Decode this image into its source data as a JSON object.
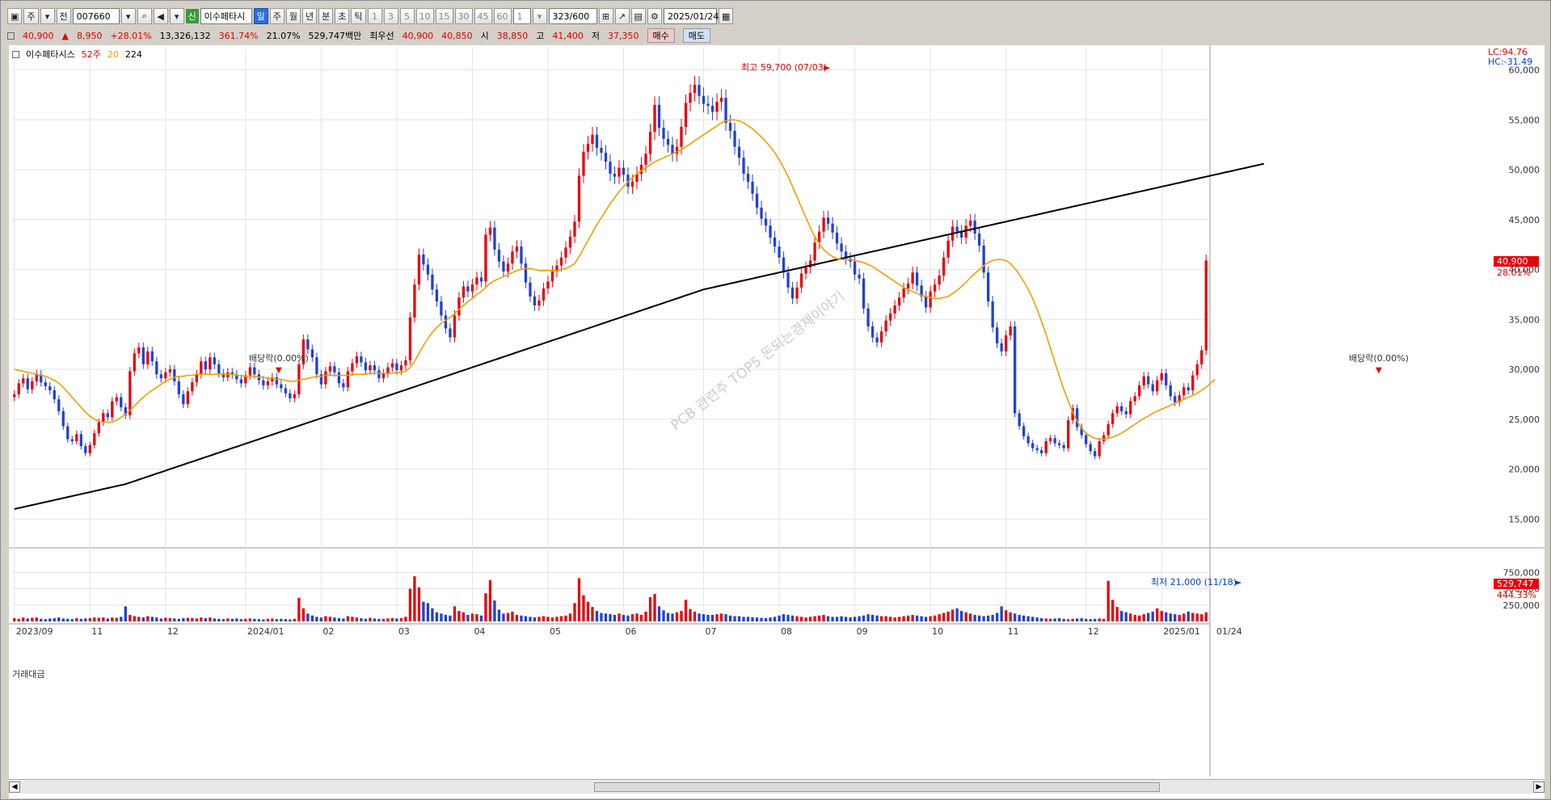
{
  "toolbar": {
    "mode": "주",
    "scope": "전",
    "code": "007660",
    "new_badge": "신",
    "name": "이수페타시",
    "periods": [
      "일",
      "주",
      "월",
      "년",
      "분",
      "초",
      "틱"
    ],
    "numbers": [
      "1",
      "3",
      "5",
      "10",
      "15",
      "30",
      "45",
      "60"
    ],
    "count_value": "1",
    "range": "323/600",
    "date": "2025/01/24"
  },
  "quote": {
    "price": "40,900",
    "change": "8,950",
    "change_pct": "+28.01%",
    "volume": "13,326,132",
    "vol_ratio": "361.74%",
    "turnover": "21.07%",
    "amount": "529,747백만",
    "priority_label": "최우선",
    "bid": "40,900",
    "ask": "40,850",
    "open_label": "시",
    "open": "38,850",
    "high_label": "고",
    "high": "41,400",
    "low_label": "저",
    "low": "37,350",
    "buy": "매수",
    "sell": "매도"
  },
  "legend": {
    "name": "이수페타시스",
    "ma1": "52주",
    "ma2": "20",
    "ma3": "224"
  },
  "volume_label": "거래대금",
  "scale_box": {
    "lc": "LC:94.76",
    "hc": "HC:-31.49"
  },
  "watermark": "PCB 관련주 TOP5 돈되는경제이야기",
  "annotations": {
    "high": "최고 59,700 (07/03)",
    "low": "최저 21,000 (11/18)",
    "div1": "배당락(0.00%)",
    "div2": "배당락(0.00%)"
  },
  "tags": {
    "price": "40,900",
    "price_pct": "28.01%",
    "vol": "529,747",
    "vol_pct": "444.33%"
  },
  "date_axis": [
    "2023/09",
    "11",
    "12",
    "2024/01",
    "02",
    "03",
    "04",
    "05",
    "06",
    "07",
    "08",
    "09",
    "10",
    "11",
    "12",
    "2025/01",
    "01/24"
  ],
  "colors": {
    "up": "#e8000b",
    "down": "#2040d8",
    "ma20": "#f0a000",
    "ma224": "#000000",
    "grid": "#e4e4e4"
  },
  "chart_data": {
    "type": "candlestick",
    "ylim": [
      13000,
      61500
    ],
    "y_ticks": [
      "15,000",
      "20,000",
      "25,000",
      "30,000",
      "35,000",
      "40,000",
      "45,000",
      "50,000",
      "55,000",
      "60,000"
    ],
    "vol_ylim": [
      0,
      1000000
    ],
    "vol_ticks": [
      "250,000",
      "500,000",
      "750,000"
    ],
    "month_starts": [
      "2023/09",
      "11",
      "12",
      "2024/01",
      "02",
      "03",
      "04",
      "05",
      "06",
      "07",
      "08",
      "09",
      "10",
      "11",
      "12",
      "2025/01"
    ],
    "closes": [
      27500,
      28600,
      29100,
      28000,
      28800,
      29500,
      28700,
      28300,
      27900,
      27000,
      25800,
      24300,
      23000,
      22800,
      23500,
      22300,
      21600,
      22400,
      23600,
      24700,
      25600,
      25200,
      26800,
      27200,
      26200,
      25400,
      29800,
      31600,
      32200,
      30500,
      31800,
      30800,
      29500,
      29100,
      29700,
      30000,
      28800,
      27500,
      26500,
      27800,
      28700,
      29500,
      30800,
      30000,
      31200,
      30500,
      29600,
      29200,
      29700,
      29500,
      29000,
      28600,
      29400,
      30200,
      29500,
      28900,
      28400,
      28800,
      29200,
      28500,
      28100,
      27600,
      27100,
      27500,
      30500,
      33000,
      32000,
      31200,
      29500,
      28500,
      29800,
      30300,
      29700,
      28600,
      28200,
      29800,
      30600,
      31300,
      30700,
      29900,
      30400,
      29900,
      29100,
      29600,
      30200,
      30600,
      29900,
      30400,
      30900,
      35200,
      38500,
      41500,
      40500,
      39500,
      38000,
      36800,
      35400,
      34100,
      33200,
      35400,
      37200,
      38300,
      37800,
      38500,
      39200,
      38800,
      43500,
      44200,
      42000,
      40800,
      39800,
      40600,
      41800,
      42300,
      40600,
      38700,
      37300,
      36400,
      36900,
      38100,
      38800,
      39800,
      40400,
      41200,
      42200,
      43300,
      44800,
      49400,
      51800,
      52600,
      53500,
      52200,
      51700,
      50800,
      49600,
      49300,
      50200,
      49500,
      48300,
      48800,
      49600,
      50500,
      51600,
      53800,
      56500,
      54200,
      53100,
      52500,
      51600,
      52300,
      54300,
      56700,
      57700,
      58500,
      57400,
      56600,
      56400,
      55800,
      56800,
      57200,
      54700,
      53900,
      52300,
      51200,
      49600,
      48800,
      47600,
      46200,
      45100,
      44400,
      43200,
      42300,
      41200,
      39700,
      38200,
      37100,
      38200,
      39600,
      40200,
      40900,
      42700,
      43800,
      45200,
      44600,
      43700,
      42600,
      41800,
      41100,
      40800,
      39500,
      39100,
      36100,
      34300,
      33200,
      32700,
      33800,
      34900,
      35600,
      36400,
      37200,
      38100,
      38600,
      39700,
      38400,
      37300,
      36200,
      37800,
      38500,
      39400,
      41200,
      42900,
      44300,
      43800,
      43200,
      44400,
      44900,
      43600,
      42400,
      39700,
      36800,
      34200,
      32600,
      31800,
      33400,
      34300,
      25600,
      24300,
      23300,
      22600,
      22100,
      21900,
      21600,
      22800,
      23100,
      22600,
      22400,
      22100,
      24900,
      26100,
      24200,
      23400,
      22500,
      21800,
      21300,
      22800,
      23400,
      24500,
      25600,
      26300,
      25800,
      25500,
      26800,
      27300,
      28400,
      29300,
      28500,
      27800,
      28900,
      29600,
      28400,
      27300,
      26700,
      27400,
      28200,
      27900,
      29400,
      30500,
      31900,
      40900
    ],
    "ma20": [
      30000,
      29900,
      29800,
      29700,
      29600,
      29500,
      29400,
      29300,
      29100,
      28900,
      28600,
      28200,
      27700,
      27200,
      26700,
      26200,
      25700,
      25300,
      25000,
      24800,
      24700,
      24700,
      24700,
      24900,
      25200,
      25500,
      25900,
      26300,
      26800,
      27200,
      27600,
      27900,
      28200,
      28500,
      28800,
      29000,
      29200,
      29300,
      29300,
      29400,
      29400,
      29500,
      29500,
      29500,
      29500,
      29500,
      29500,
      29500,
      29500,
      29500,
      29400,
      29400,
      29300,
      29300,
      29300,
      29200,
      29200,
      29100,
      29100,
      29000,
      29000,
      28900,
      28800,
      28800,
      28900,
      29000,
      29100,
      29200,
      29300,
      29300,
      29400,
      29400,
      29400,
      29400,
      29400,
      29400,
      29500,
      29500,
      29500,
      29500,
      29600,
      29600,
      29600,
      29600,
      29600,
      29600,
      29700,
      29700,
      29800,
      30200,
      30800,
      31600,
      32400,
      33100,
      33700,
      34200,
      34600,
      34900,
      35200,
      35600,
      36000,
      36400,
      36800,
      37100,
      37500,
      37800,
      38200,
      38600,
      38900,
      39100,
      39300,
      39500,
      39700,
      39900,
      40000,
      40100,
      40100,
      40000,
      39900,
      39900,
      39900,
      39900,
      39900,
      40000,
      40100,
      40300,
      40600,
      41300,
      42100,
      42900,
      43700,
      44500,
      45200,
      45900,
      46600,
      47200,
      47800,
      48300,
      48800,
      49200,
      49600,
      49900,
      50200,
      50500,
      50800,
      51000,
      51200,
      51400,
      51600,
      51800,
      52000,
      52300,
      52600,
      52900,
      53200,
      53500,
      53800,
      54100,
      54400,
      54700,
      54900,
      55000,
      55000,
      54900,
      54700,
      54400,
      54100,
      53700,
      53300,
      52800,
      52300,
      51700,
      51000,
      50200,
      49300,
      48300,
      47300,
      46200,
      45200,
      44200,
      43300,
      42600,
      42000,
      41600,
      41300,
      41100,
      41000,
      41000,
      41000,
      40900,
      40800,
      40700,
      40500,
      40300,
      40000,
      39700,
      39400,
      39100,
      38800,
      38500,
      38200,
      38000,
      37800,
      37600,
      37400,
      37300,
      37200,
      37100,
      37100,
      37200,
      37300,
      37600,
      37900,
      38300,
      38700,
      39200,
      39600,
      40000,
      40400,
      40700,
      40900,
      41000,
      41000,
      40900,
      40600,
      40100,
      39500,
      38800,
      38000,
      37100,
      36000,
      34800,
      33500,
      32100,
      30700,
      29300,
      28000,
      26800,
      25700,
      24800,
      24100,
      23600,
      23300,
      23100,
      23000,
      23000,
      23100,
      23200,
      23400,
      23600,
      23900,
      24200,
      24500,
      24800,
      25100,
      25300,
      25600,
      25800,
      26000,
      26200,
      26400,
      26600,
      26800,
      27000,
      27200,
      27400,
      27600,
      27900,
      28200,
      28600,
      29000
    ],
    "ma224": [
      16000,
      16100,
      16200,
      16300,
      16400,
      16500,
      16600,
      16700,
      16800,
      16900,
      17000,
      17100,
      17200,
      17300,
      17400,
      17500,
      17600,
      17700,
      17800,
      17900,
      18000,
      18100,
      18200,
      18300,
      18400,
      18500,
      18650,
      18800,
      18950,
      19100,
      19250,
      19400,
      19550,
      19700,
      19850,
      20000,
      20150,
      20300,
      20450,
      20600,
      20750,
      20900,
      21050,
      21200,
      21350,
      21500,
      21650,
      21800,
      21950,
      22100,
      22250,
      22400,
      22550,
      22700,
      22850,
      23000,
      23150,
      23300,
      23450,
      23600,
      23750,
      23900,
      24050,
      24200,
      24350,
      24500,
      24650,
      24800,
      24950,
      25100,
      25250,
      25400,
      25550,
      25700,
      25850,
      26000,
      26150,
      26300,
      26450,
      26600,
      26750,
      26900,
      27050,
      27200,
      27350,
      27500,
      27650,
      27800,
      27950,
      28100,
      28250,
      28400,
      28550,
      28700,
      28850,
      29000,
      29150,
      29300,
      29450,
      29600,
      29750,
      29900,
      30050,
      30200,
      30350,
      30500,
      30650,
      30800,
      30950,
      31100,
      31250,
      31400,
      31550,
      31700,
      31850,
      32000,
      32150,
      32300,
      32450,
      32600,
      32750,
      32900,
      33050,
      33200,
      33350,
      33500,
      33650,
      33800,
      33950,
      34100,
      34250,
      34400,
      34550,
      34700,
      34850,
      35000,
      35150,
      35300,
      35450,
      35600,
      35750,
      35900,
      36050,
      36200,
      36350,
      36500,
      36650,
      36800,
      36950,
      37100,
      37250,
      37400,
      37550,
      37700,
      37850,
      38000,
      38100,
      38200,
      38300,
      38400,
      38500,
      38600,
      38700,
      38800,
      38900,
      39000,
      39100,
      39200,
      39300,
      39400,
      39500,
      39600,
      39700,
      39800,
      39900,
      40000,
      40100,
      40200,
      40300,
      40400,
      40500,
      40600,
      40700,
      40800,
      40900,
      41000,
      41100,
      41200,
      41300,
      41400,
      41500,
      41600,
      41700,
      41800,
      41900,
      42000,
      42100,
      42200,
      42300,
      42400,
      42500,
      42600,
      42700,
      42800,
      42900,
      43000,
      43100,
      43200,
      43300,
      43400,
      43500,
      43600,
      43700,
      43800,
      43900,
      44000,
      44100,
      44200,
      44300,
      44400,
      44500,
      44600,
      44700,
      44800,
      44900,
      45000,
      45100,
      45200,
      45300,
      45400,
      45500,
      45600,
      45700,
      45800,
      45900,
      46000,
      46100,
      46200,
      46300,
      46400,
      46500,
      46600,
      46700,
      46800,
      46900,
      47000,
      47100,
      47200,
      47300,
      47400,
      47500,
      47600,
      47700,
      47800,
      47900,
      48000,
      48100,
      48200,
      48300,
      48400,
      48500,
      48600,
      48700,
      48800,
      48900,
      49000,
      49100,
      49200,
      49300,
      49400,
      49500,
      49600,
      49700,
      49800,
      49900,
      50000,
      50100,
      50200,
      50300,
      50400,
      50500,
      50600
    ],
    "volumes": [
      50000,
      40000,
      60000,
      45000,
      55000,
      60000,
      40000,
      35000,
      45000,
      50000,
      60000,
      45000,
      40000,
      35000,
      50000,
      40000,
      45000,
      50000,
      60000,
      55000,
      60000,
      45000,
      60000,
      55000,
      70000,
      230000,
      100000,
      80000,
      70000,
      60000,
      80000,
      70000,
      60000,
      45000,
      55000,
      50000,
      45000,
      40000,
      50000,
      55000,
      50000,
      45000,
      60000,
      50000,
      60000,
      45000,
      40000,
      35000,
      45000,
      40000,
      45000,
      35000,
      40000,
      45000,
      40000,
      35000,
      30000,
      40000,
      45000,
      35000,
      40000,
      35000,
      30000,
      40000,
      360000,
      200000,
      120000,
      90000,
      70000,
      60000,
      80000,
      70000,
      60000,
      50000,
      45000,
      80000,
      70000,
      60000,
      50000,
      40000,
      55000,
      45000,
      40000,
      40000,
      45000,
      50000,
      45000,
      50000,
      70000,
      500000,
      690000,
      520000,
      300000,
      280000,
      200000,
      140000,
      120000,
      100000,
      90000,
      230000,
      160000,
      140000,
      100000,
      120000,
      110000,
      90000,
      430000,
      630000,
      320000,
      180000,
      120000,
      130000,
      150000,
      100000,
      90000,
      80000,
      70000,
      60000,
      70000,
      80000,
      70000,
      60000,
      70000,
      80000,
      90000,
      120000,
      280000,
      660000,
      400000,
      300000,
      220000,
      160000,
      130000,
      120000,
      110000,
      100000,
      120000,
      100000,
      90000,
      110000,
      120000,
      100000,
      150000,
      370000,
      420000,
      230000,
      170000,
      130000,
      120000,
      140000,
      160000,
      330000,
      190000,
      150000,
      120000,
      110000,
      100000,
      100000,
      110000,
      120000,
      110000,
      90000,
      80000,
      80000,
      70000,
      70000,
      65000,
      60000,
      55000,
      50000,
      60000,
      70000,
      90000,
      110000,
      100000,
      90000,
      80000,
      70000,
      60000,
      70000,
      80000,
      90000,
      100000,
      80000,
      70000,
      70000,
      80000,
      70000,
      60000,
      70000,
      80000,
      90000,
      110000,
      100000,
      90000,
      80000,
      80000,
      70000,
      60000,
      70000,
      80000,
      90000,
      100000,
      90000,
      80000,
      70000,
      80000,
      90000,
      110000,
      130000,
      150000,
      180000,
      200000,
      160000,
      140000,
      120000,
      100000,
      90000,
      80000,
      90000,
      100000,
      130000,
      230000,
      170000,
      140000,
      120000,
      100000,
      90000,
      80000,
      70000,
      60000,
      50000,
      45000,
      40000,
      45000,
      50000,
      40000,
      35000,
      40000,
      45000,
      50000,
      40000,
      35000,
      40000,
      45000,
      40000,
      620000,
      330000,
      220000,
      160000,
      140000,
      120000,
      100000,
      90000,
      110000,
      130000,
      150000,
      200000,
      160000,
      140000,
      120000,
      110000,
      100000,
      120000,
      150000,
      130000,
      120000,
      110000,
      140000,
      160000,
      140000,
      120000,
      110000,
      130000,
      120000,
      110000,
      600000
    ]
  }
}
